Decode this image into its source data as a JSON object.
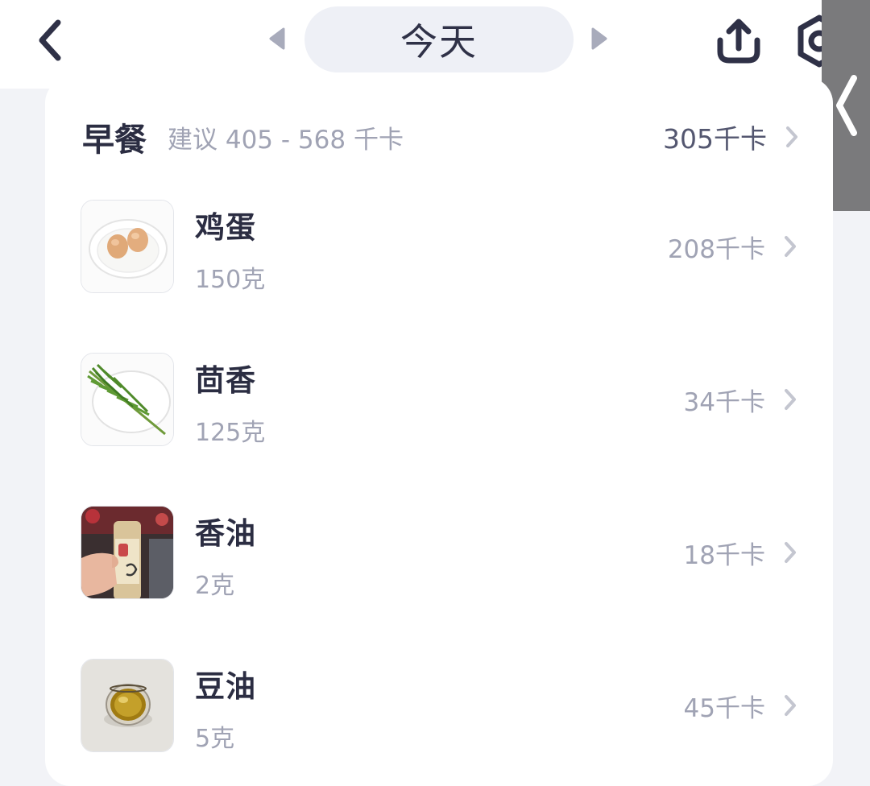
{
  "header": {
    "date_label": "今天"
  },
  "meal": {
    "title": "早餐",
    "suggestion": "建议 405 - 568 千卡",
    "total": "305千卡"
  },
  "foods": [
    {
      "name": "鸡蛋",
      "amount": "150克",
      "kcal": "208千卡",
      "image": "eggs-on-plate"
    },
    {
      "name": "茴香",
      "amount": "125克",
      "kcal": "34千卡",
      "image": "fennel-on-plate"
    },
    {
      "name": "香油",
      "amount": "2克",
      "kcal": "18千卡",
      "image": "sesame-oil-bottle"
    },
    {
      "name": "豆油",
      "amount": "5克",
      "kcal": "45千卡",
      "image": "soybean-oil-bowl"
    }
  ],
  "icons": {
    "back": "chevron-left-icon",
    "prev": "triangle-left-icon",
    "next": "triangle-right-icon",
    "share": "share-upload-icon",
    "settings": "settings-icon",
    "handle": "chevron-left-icon",
    "row_arrow": "chevron-right-icon"
  },
  "colors": {
    "page_bg": "#f2f3f7",
    "card_bg": "#ffffff",
    "primary_text": "#2b2d42",
    "secondary_text": "#a0a3b4",
    "pill_bg": "#eef0f6",
    "handle_bg": "#7a7a7c"
  }
}
